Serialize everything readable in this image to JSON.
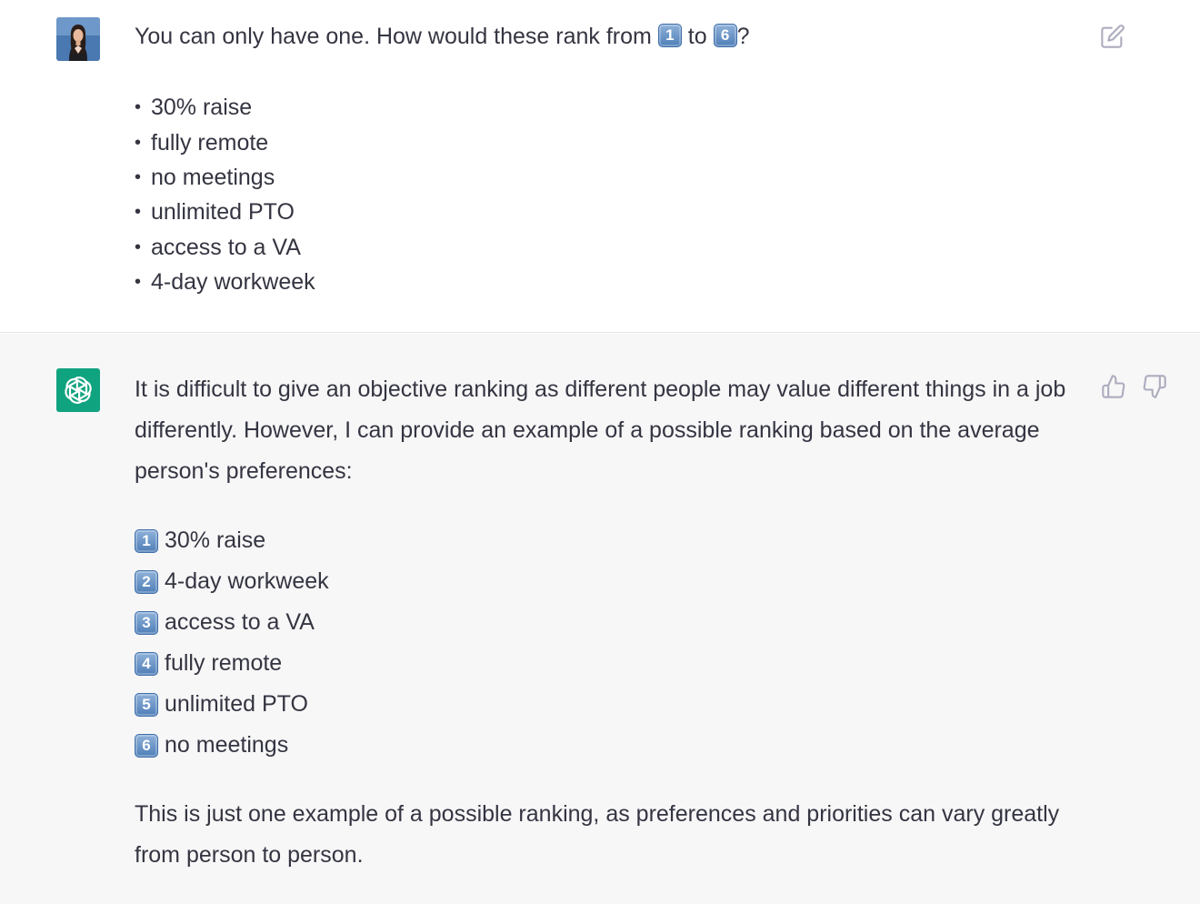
{
  "user_message": {
    "avatar": "user-avatar-photo",
    "text_before": "You can only have one. How would these rank from ",
    "keycap_start": "1",
    "text_middle": " to ",
    "keycap_end": "6",
    "text_after": "?",
    "bullet": "•",
    "items": [
      "30% raise",
      "fully remote",
      "no meetings",
      "unlimited PTO",
      "access to a VA",
      "4-day workweek"
    ],
    "edit_icon": "edit-icon"
  },
  "assistant_message": {
    "avatar": "openai-logo-icon",
    "intro": "It is difficult to give an objective ranking as different people may value different things in a job differently. However, I can provide an example of a possible ranking based on the average person's preferences:",
    "ranking": [
      {
        "rank": "1",
        "label": "30% raise"
      },
      {
        "rank": "2",
        "label": "4-day workweek"
      },
      {
        "rank": "3",
        "label": "access to a VA"
      },
      {
        "rank": "4",
        "label": "fully remote"
      },
      {
        "rank": "5",
        "label": "unlimited PTO"
      },
      {
        "rank": "6",
        "label": "no meetings"
      }
    ],
    "outro": "This is just one example of a possible ranking, as preferences and priorities can vary greatly from person to person.",
    "feedback_icons": [
      "thumbs-up-icon",
      "thumbs-down-icon"
    ]
  },
  "colors": {
    "text": "#343541",
    "assistant_bg": "#f7f7f8",
    "openai_green": "#10a37f",
    "icon_gray": "#acacbe"
  }
}
